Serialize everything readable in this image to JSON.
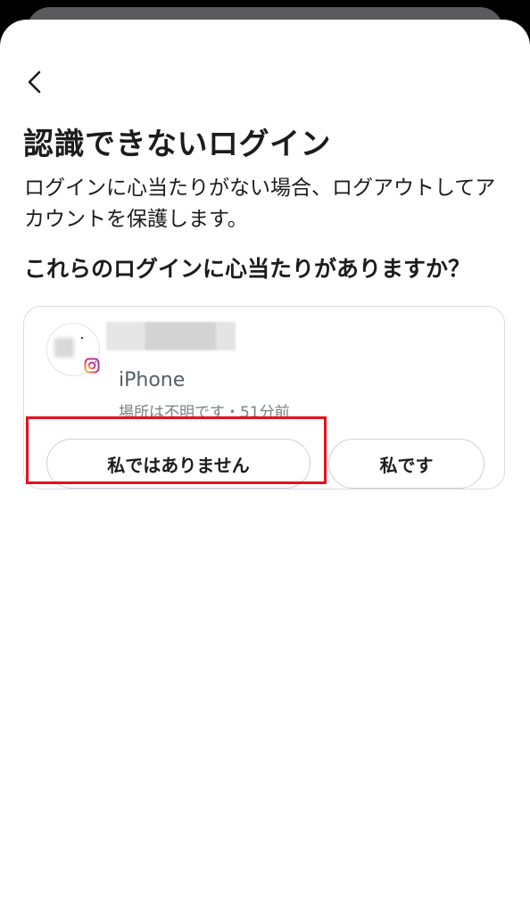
{
  "header": {
    "back_icon": "chevron-left-icon"
  },
  "page": {
    "title": "認識できないログイン",
    "description": "ログインに心当たりがない場合、ログアウトしてアカウントを保護します。",
    "question": "これらのログインに心当たりがありますか？"
  },
  "login": {
    "app_icon": "instagram-icon",
    "device": "iPhone",
    "meta": "場所は不明です・51分前",
    "buttons": {
      "not_me": "私ではありません",
      "me": "私です"
    }
  },
  "colors": {
    "highlight": "#e8101d",
    "card_border": "#dbdbdb",
    "text_primary": "#1c1c1c"
  }
}
